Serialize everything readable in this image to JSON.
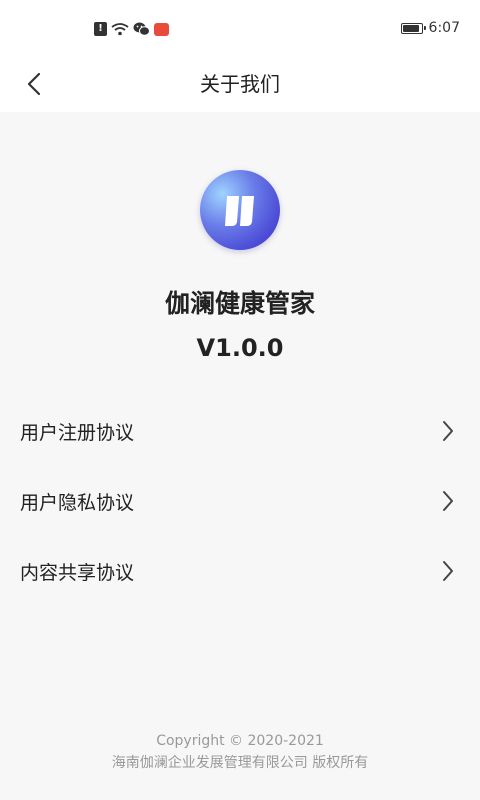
{
  "status_bar": {
    "time": "6:07"
  },
  "nav": {
    "title": "关于我们"
  },
  "app": {
    "name": "伽澜健康管家",
    "version": "V1.0.0"
  },
  "menu": {
    "items": [
      {
        "label": "用户注册协议"
      },
      {
        "label": "用户隐私协议"
      },
      {
        "label": "内容共享协议"
      }
    ]
  },
  "footer": {
    "copyright": "Copyright © 2020-2021",
    "company": "海南伽澜企业发展管理有限公司 版权所有"
  },
  "colors": {
    "background": "#f7f7f7",
    "header": "#ffffff",
    "text": "#222222",
    "muted_text": "#999999",
    "logo_primary": "#4b4bd6"
  }
}
